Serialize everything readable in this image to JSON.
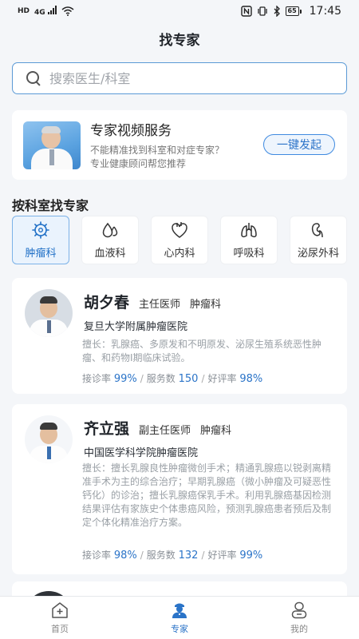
{
  "status_bar": {
    "left_icons": [
      "hd-icon",
      "4g-signal-icon",
      "wifi-icon"
    ],
    "hd_label": "HD",
    "network_label": "4G",
    "right_icons": [
      "nfc-icon",
      "vibrate-icon",
      "bluetooth-icon",
      "battery-icon"
    ],
    "battery_level": "65",
    "time": "17:45"
  },
  "page": {
    "title": "找专家"
  },
  "search": {
    "placeholder": "搜索医生/科室"
  },
  "service": {
    "title": "专家视频服务",
    "line1": "不能精准找到科室和对症专家？",
    "line2": "专业健康顾问帮您推荐",
    "button": "一键发起"
  },
  "departments": {
    "title": "按科室找专家",
    "items": [
      {
        "label": "肿瘤科",
        "icon": "tumor-icon",
        "active": true
      },
      {
        "label": "血液科",
        "icon": "blood-drops-icon",
        "active": false
      },
      {
        "label": "心内科",
        "icon": "heart-icon",
        "active": false
      },
      {
        "label": "呼吸科",
        "icon": "lungs-icon",
        "active": false
      },
      {
        "label": "泌尿外科",
        "icon": "kidney-icon",
        "active": false
      }
    ]
  },
  "doctors": [
    {
      "name": "胡夕春",
      "title": "主任医师",
      "dept": "肿瘤科",
      "hospital": "复旦大学附属肿瘤医院",
      "desc": "擅长：乳腺癌、多原发和不明原发、泌尿生殖系统恶性肿瘤、和药物I期临床试验。",
      "consult_label": "接诊率",
      "consult_rate": "99%",
      "service_label": "服务数",
      "service_count": "150",
      "rating_label": "好评率",
      "rating": "98%"
    },
    {
      "name": "齐立强",
      "title": "副主任医师",
      "dept": "肿瘤科",
      "hospital": "中国医学科学院肿瘤医院",
      "desc": "擅长：擅长乳腺良性肿瘤微创手术；精通乳腺癌以锐剥离精准手术为主的综合治疗；早期乳腺癌（微小肿瘤及可疑恶性钙化）的诊治；擅长乳腺癌保乳手术。利用乳腺癌基因检测结果评估有家族史个体患癌风险，预测乳腺癌患者预后及制定个体化精准治疗方案。",
      "consult_label": "接诊率",
      "consult_rate": "98%",
      "service_label": "服务数",
      "service_count": "132",
      "rating_label": "好评率",
      "rating": "99%"
    }
  ],
  "tab_bar": {
    "items": [
      {
        "label": "首页",
        "icon": "home-plus-icon",
        "active": false
      },
      {
        "label": "专家",
        "icon": "doctor-icon",
        "active": true
      },
      {
        "label": "我的",
        "icon": "profile-icon",
        "active": false
      }
    ]
  },
  "colors": {
    "accent": "#2b74c8",
    "active_border": "#7cb2e8",
    "background": "#f4f6f9"
  }
}
